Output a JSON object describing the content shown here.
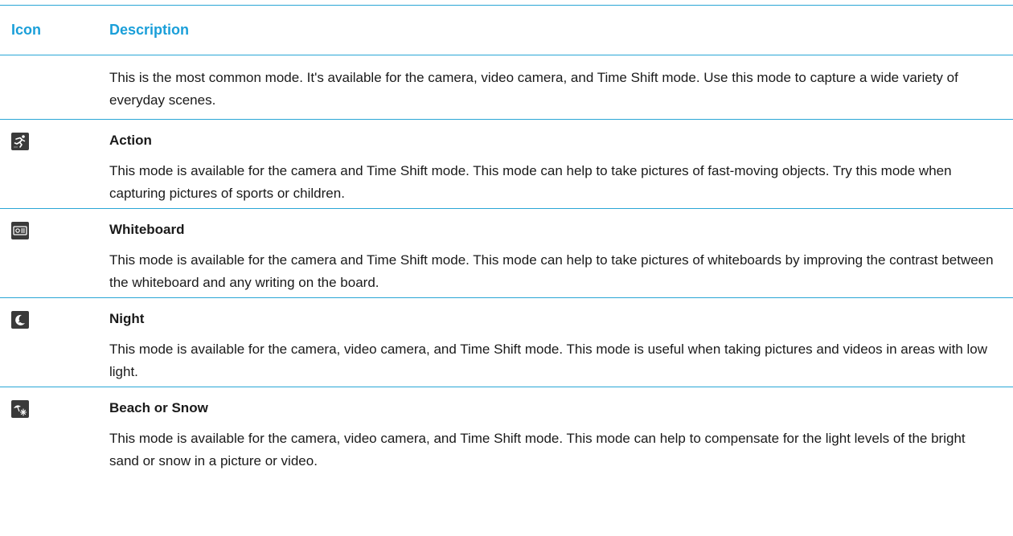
{
  "table": {
    "headers": {
      "icon": "Icon",
      "description": "Description"
    },
    "rows": [
      {
        "icon": "",
        "title": "",
        "text": "This is the most common mode. It's available for the camera, video camera, and Time Shift mode. Use this mode to capture a wide variety of everyday scenes."
      },
      {
        "icon": "action-mode-icon",
        "title": "Action",
        "text": "This mode is available for the camera and Time Shift mode. This mode can help to take pictures of fast-moving objects. Try this mode when capturing pictures of sports or children."
      },
      {
        "icon": "whiteboard-mode-icon",
        "title": "Whiteboard",
        "text": "This mode is available for the camera and Time Shift mode. This mode can help to take pictures of whiteboards by improving the contrast between the whiteboard and any writing on the board."
      },
      {
        "icon": "night-mode-icon",
        "title": "Night",
        "text": "This mode is available for the camera, video camera, and Time Shift mode. This mode is useful when taking pictures and videos in areas with low light."
      },
      {
        "icon": "beach-snow-mode-icon",
        "title": "Beach or Snow",
        "text": "This mode is available for the camera, video camera, and Time Shift mode. This mode can help to compensate for the light levels of the bright sand or snow in a picture or video."
      }
    ]
  },
  "colors": {
    "accent": "#1a9fd9",
    "rule": "#2aa6d6",
    "icon_bg": "#3a3a3a",
    "text": "#1a1a1a"
  }
}
